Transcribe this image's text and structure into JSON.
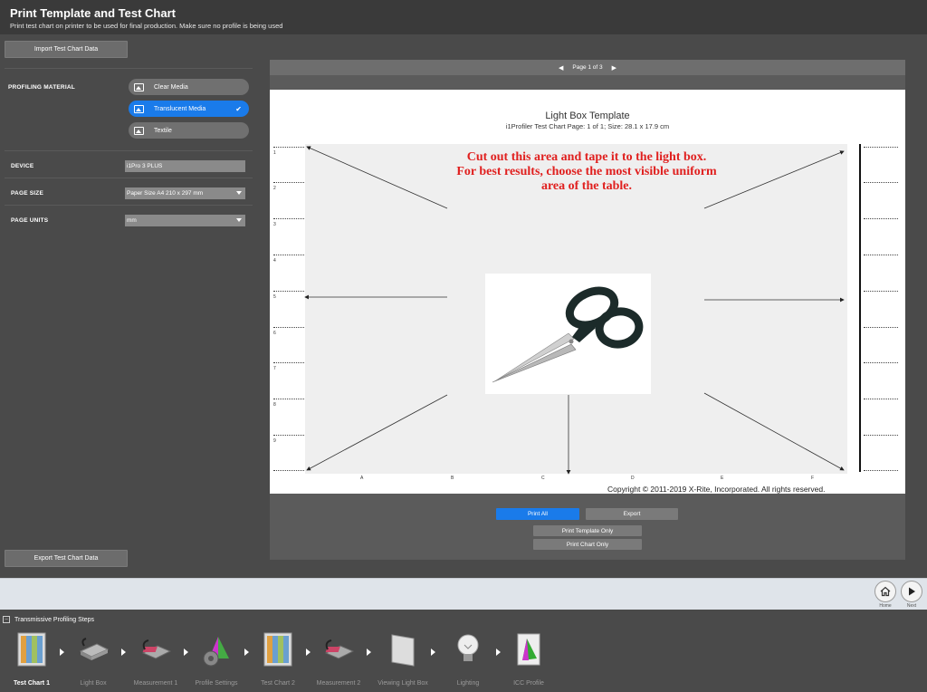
{
  "header": {
    "title": "Print Template and Test Chart",
    "subtitle": "Print test chart on printer to be used for final production. Make sure no profile is being used"
  },
  "left_panel": {
    "import_label": "Import Test Chart Data",
    "export_label": "Export Test Chart Data",
    "profiling_material_label": "PROFILING MATERIAL",
    "media": [
      {
        "label": "Clear Media",
        "selected": false
      },
      {
        "label": "Translucent Media",
        "selected": true
      },
      {
        "label": "Textile",
        "selected": false
      }
    ],
    "check_glyph": "✔",
    "device_label": "DEVICE",
    "device_value": "i1Pro 3 PLUS",
    "page_size_label": "PAGE SIZE",
    "page_size_value": "Paper Size A4  210 x 297 mm",
    "page_units_label": "PAGE UNITS",
    "page_units_value": "mm"
  },
  "preview": {
    "pager_text": "Page 1 of 3",
    "page_title": "Light Box Template",
    "page_subtitle": "i1Profiler Test Chart Page: 1 of 1; Size: 28.1 x 17.9 cm",
    "cut_text_line1": "Cut out this area and tape it to the light box.",
    "cut_text_line2": "For best results, choose the most visible uniform",
    "cut_text_line3": "area of the table.",
    "copyright": "Copyright © 2011-2019 X-Rite, Incorporated. All rights reserved.",
    "row_numbers": [
      "1",
      "2",
      "3",
      "4",
      "5",
      "6",
      "7",
      "8",
      "9"
    ],
    "column_letters": [
      "A",
      "B",
      "C",
      "D",
      "E",
      "F"
    ]
  },
  "actions": {
    "print_all": "Print All",
    "export": "Export",
    "print_template_only": "Print Template Only",
    "print_chart_only": "Print Chart Only"
  },
  "nav": {
    "home_label": "Home",
    "next_label": "Next"
  },
  "steps": {
    "header": "Transmissive Profiling Steps",
    "items": [
      {
        "label": "Test Chart 1",
        "icon": "test-chart-icon",
        "active": true
      },
      {
        "label": "Light Box",
        "icon": "light-box-icon",
        "active": false
      },
      {
        "label": "Measurement 1",
        "icon": "measurement-icon",
        "active": false
      },
      {
        "label": "Profile Settings",
        "icon": "profile-settings-icon",
        "active": false
      },
      {
        "label": "Test Chart 2",
        "icon": "test-chart-icon",
        "active": false
      },
      {
        "label": "Measurement 2",
        "icon": "measurement-icon",
        "active": false
      },
      {
        "label": "Viewing Light Box",
        "icon": "viewing-light-box-icon",
        "active": false
      },
      {
        "label": "Lighting",
        "icon": "lightbulb-icon",
        "active": false
      },
      {
        "label": "ICC Profile",
        "icon": "icc-profile-icon",
        "active": false
      }
    ]
  },
  "colors": {
    "accent": "#1a7bea",
    "warning_text": "#e0201f"
  }
}
